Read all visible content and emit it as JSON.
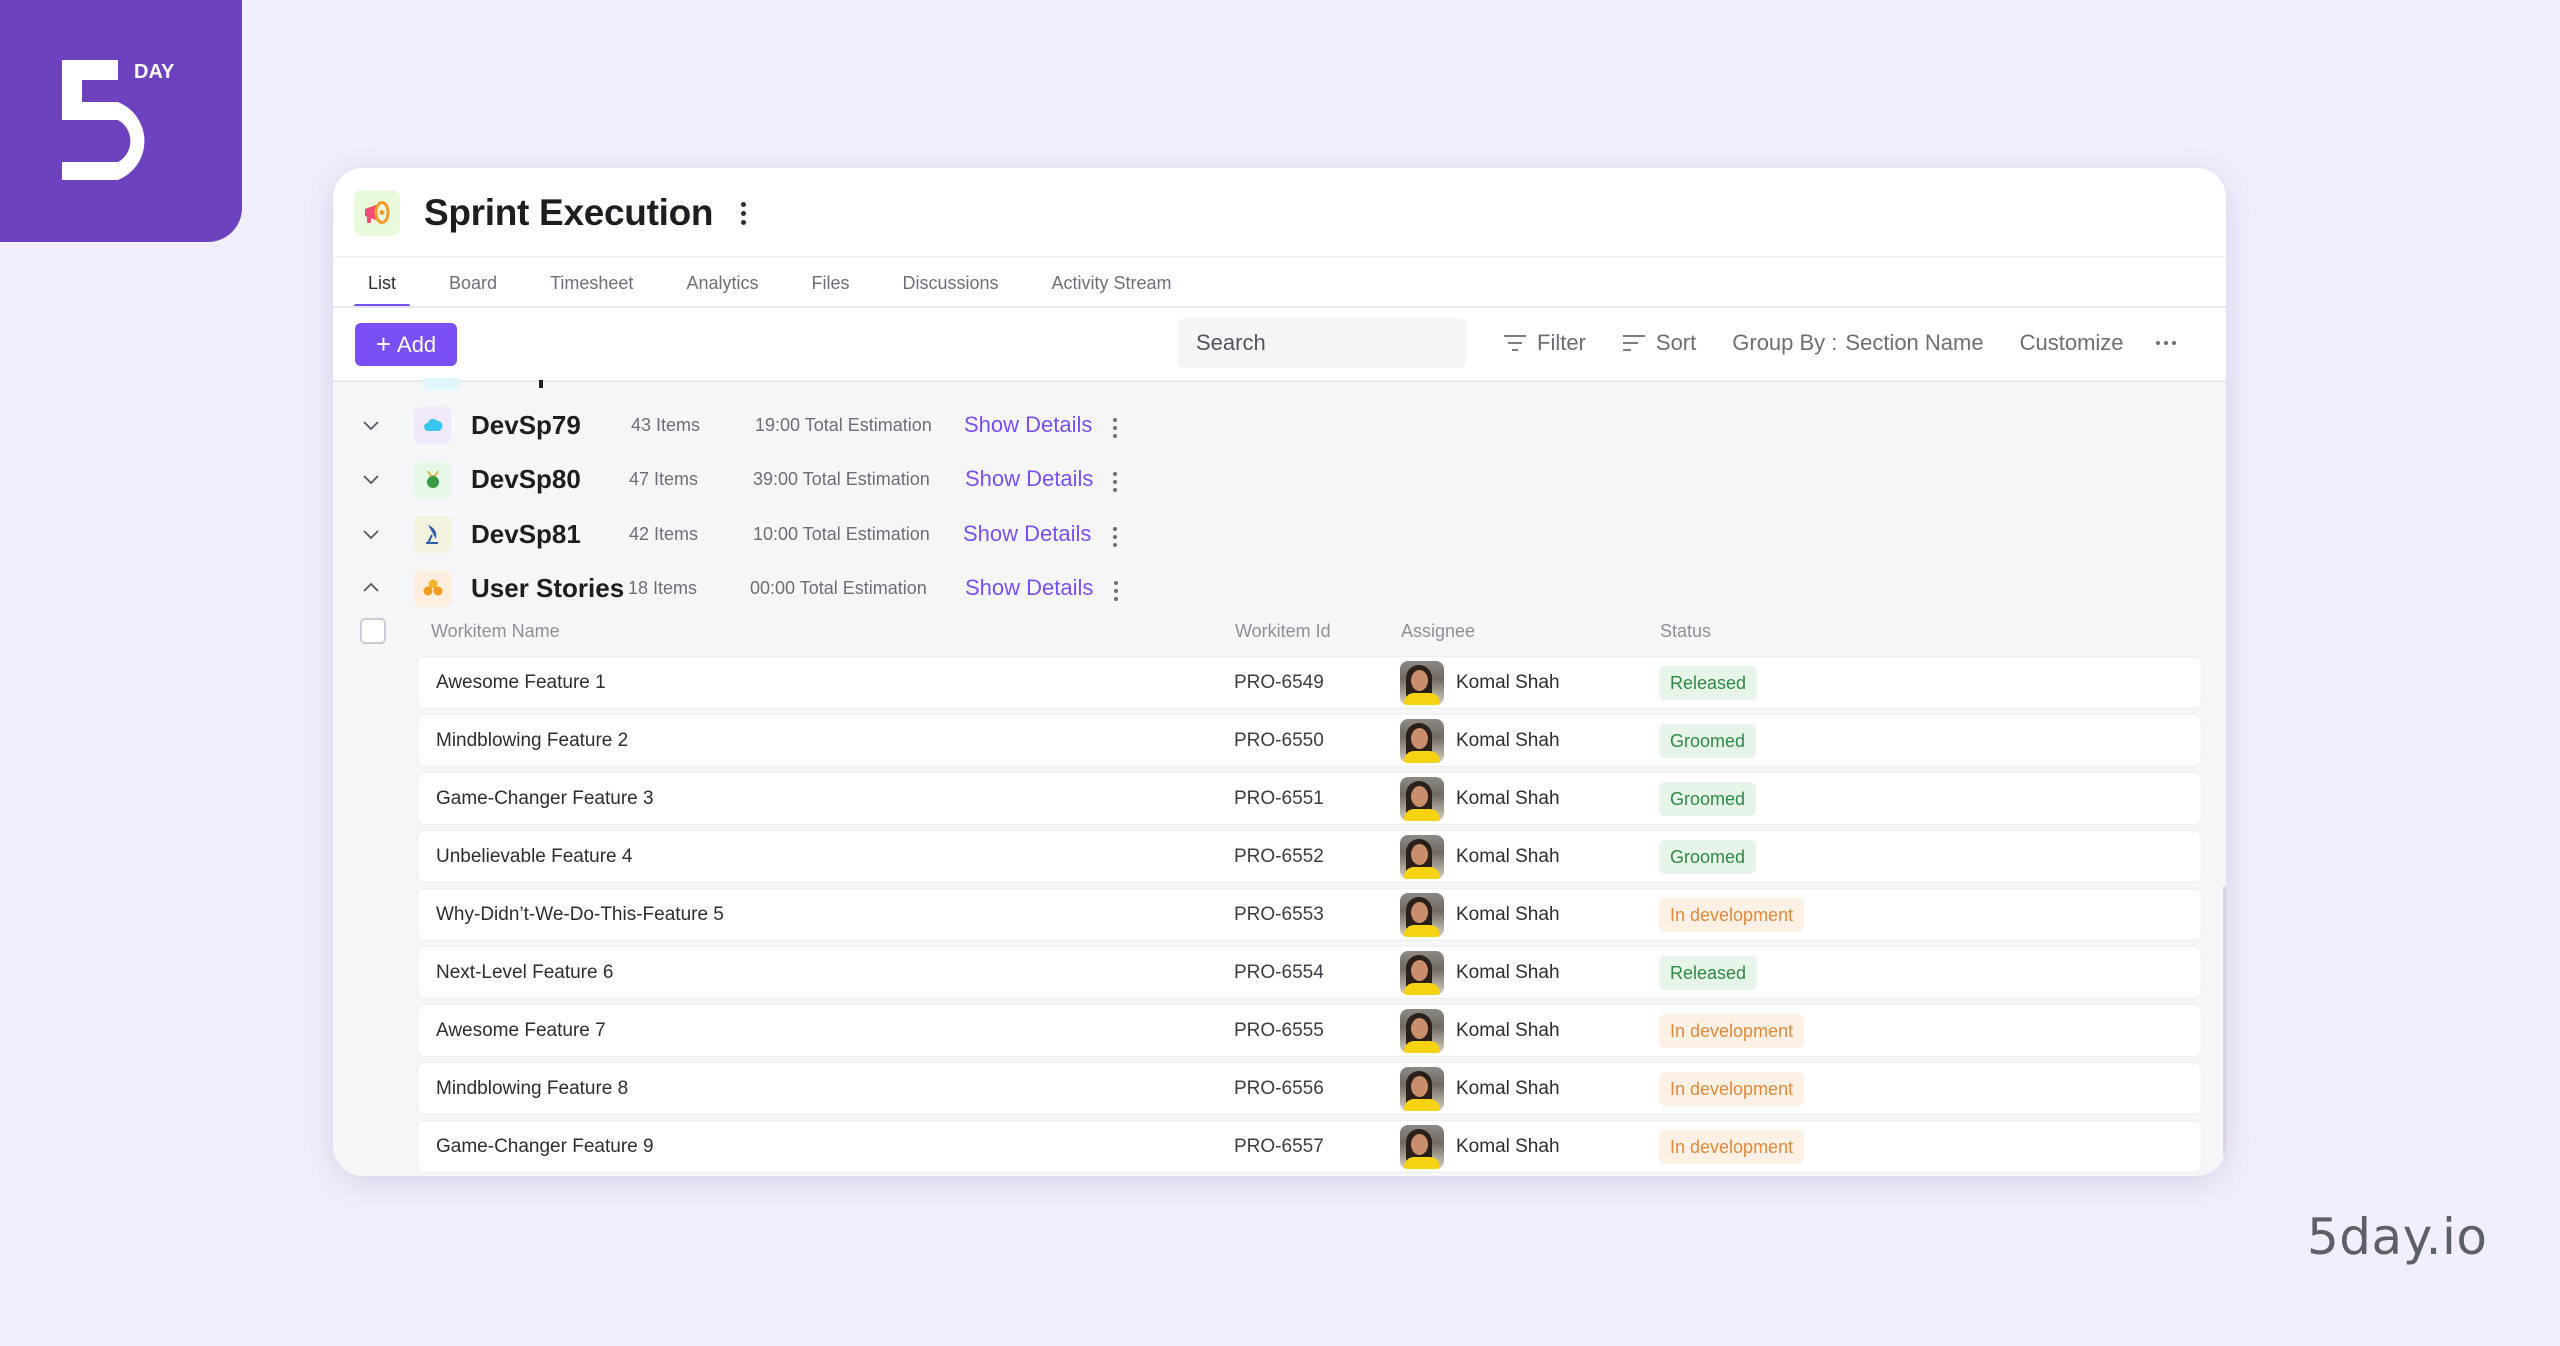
{
  "brand": {
    "logo_text": "DAY",
    "url": "5day.io",
    "accent": "#7a4ff5",
    "logo_bg": "#6c42be"
  },
  "header": {
    "title": "Sprint Execution",
    "icon": "megaphone-icon"
  },
  "tabs": [
    {
      "label": "List",
      "active": true
    },
    {
      "label": "Board",
      "active": false
    },
    {
      "label": "Timesheet",
      "active": false
    },
    {
      "label": "Analytics",
      "active": false
    },
    {
      "label": "Files",
      "active": false
    },
    {
      "label": "Discussions",
      "active": false
    },
    {
      "label": "Activity Stream",
      "active": false
    }
  ],
  "toolbar": {
    "add_label": "Add",
    "search_placeholder": "Search",
    "filter_label": "Filter",
    "sort_label": "Sort",
    "group_by_label": "Group By :",
    "group_by_value": "Section Name",
    "customize_label": "Customize"
  },
  "groups": [
    {
      "name": "DevSp79",
      "count": "43 Items",
      "estimation": "19:00 Total Estimation",
      "action": "Show Details",
      "expanded": false,
      "icon": "cloud-icon"
    },
    {
      "name": "DevSp80",
      "count": "47 Items",
      "estimation": "39:00 Total Estimation",
      "action": "Show Details",
      "expanded": false,
      "icon": "money-bag-icon"
    },
    {
      "name": "DevSp81",
      "count": "42 Items",
      "estimation": "10:00 Total Estimation",
      "action": "Show Details",
      "expanded": false,
      "icon": "satellite-dish-icon"
    },
    {
      "name": "User Stories",
      "count": "18 Items",
      "estimation": "00:00 Total Estimation",
      "action": "Show Details",
      "expanded": true,
      "icon": "stack-icon"
    }
  ],
  "table": {
    "columns": [
      "Workitem Name",
      "Workitem Id",
      "Assignee",
      "Status"
    ],
    "rows": [
      {
        "name": "Awesome Feature 1",
        "id": "PRO-6549",
        "assignee": "Komal Shah",
        "status": "Released"
      },
      {
        "name": "Mindblowing Feature 2",
        "id": "PRO-6550",
        "assignee": "Komal Shah",
        "status": "Groomed"
      },
      {
        "name": "Game-Changer Feature 3",
        "id": "PRO-6551",
        "assignee": "Komal Shah",
        "status": "Groomed"
      },
      {
        "name": "Unbelievable Feature 4",
        "id": "PRO-6552",
        "assignee": "Komal Shah",
        "status": "Groomed"
      },
      {
        "name": "Why-Didn’t-We-Do-This-Feature 5",
        "id": "PRO-6553",
        "assignee": "Komal Shah",
        "status": "In development"
      },
      {
        "name": "Next-Level Feature 6",
        "id": "PRO-6554",
        "assignee": "Komal Shah",
        "status": "Released"
      },
      {
        "name": "Awesome Feature 7",
        "id": "PRO-6555",
        "assignee": "Komal Shah",
        "status": "In development"
      },
      {
        "name": "Mindblowing Feature 8",
        "id": "PRO-6556",
        "assignee": "Komal Shah",
        "status": "In development"
      },
      {
        "name": "Game-Changer Feature 9",
        "id": "PRO-6557",
        "assignee": "Komal Shah",
        "status": "In development"
      }
    ]
  },
  "status_colors": {
    "Released": "#2e8a43",
    "Groomed": "#2e8a43",
    "In development": "#e08a3c"
  }
}
